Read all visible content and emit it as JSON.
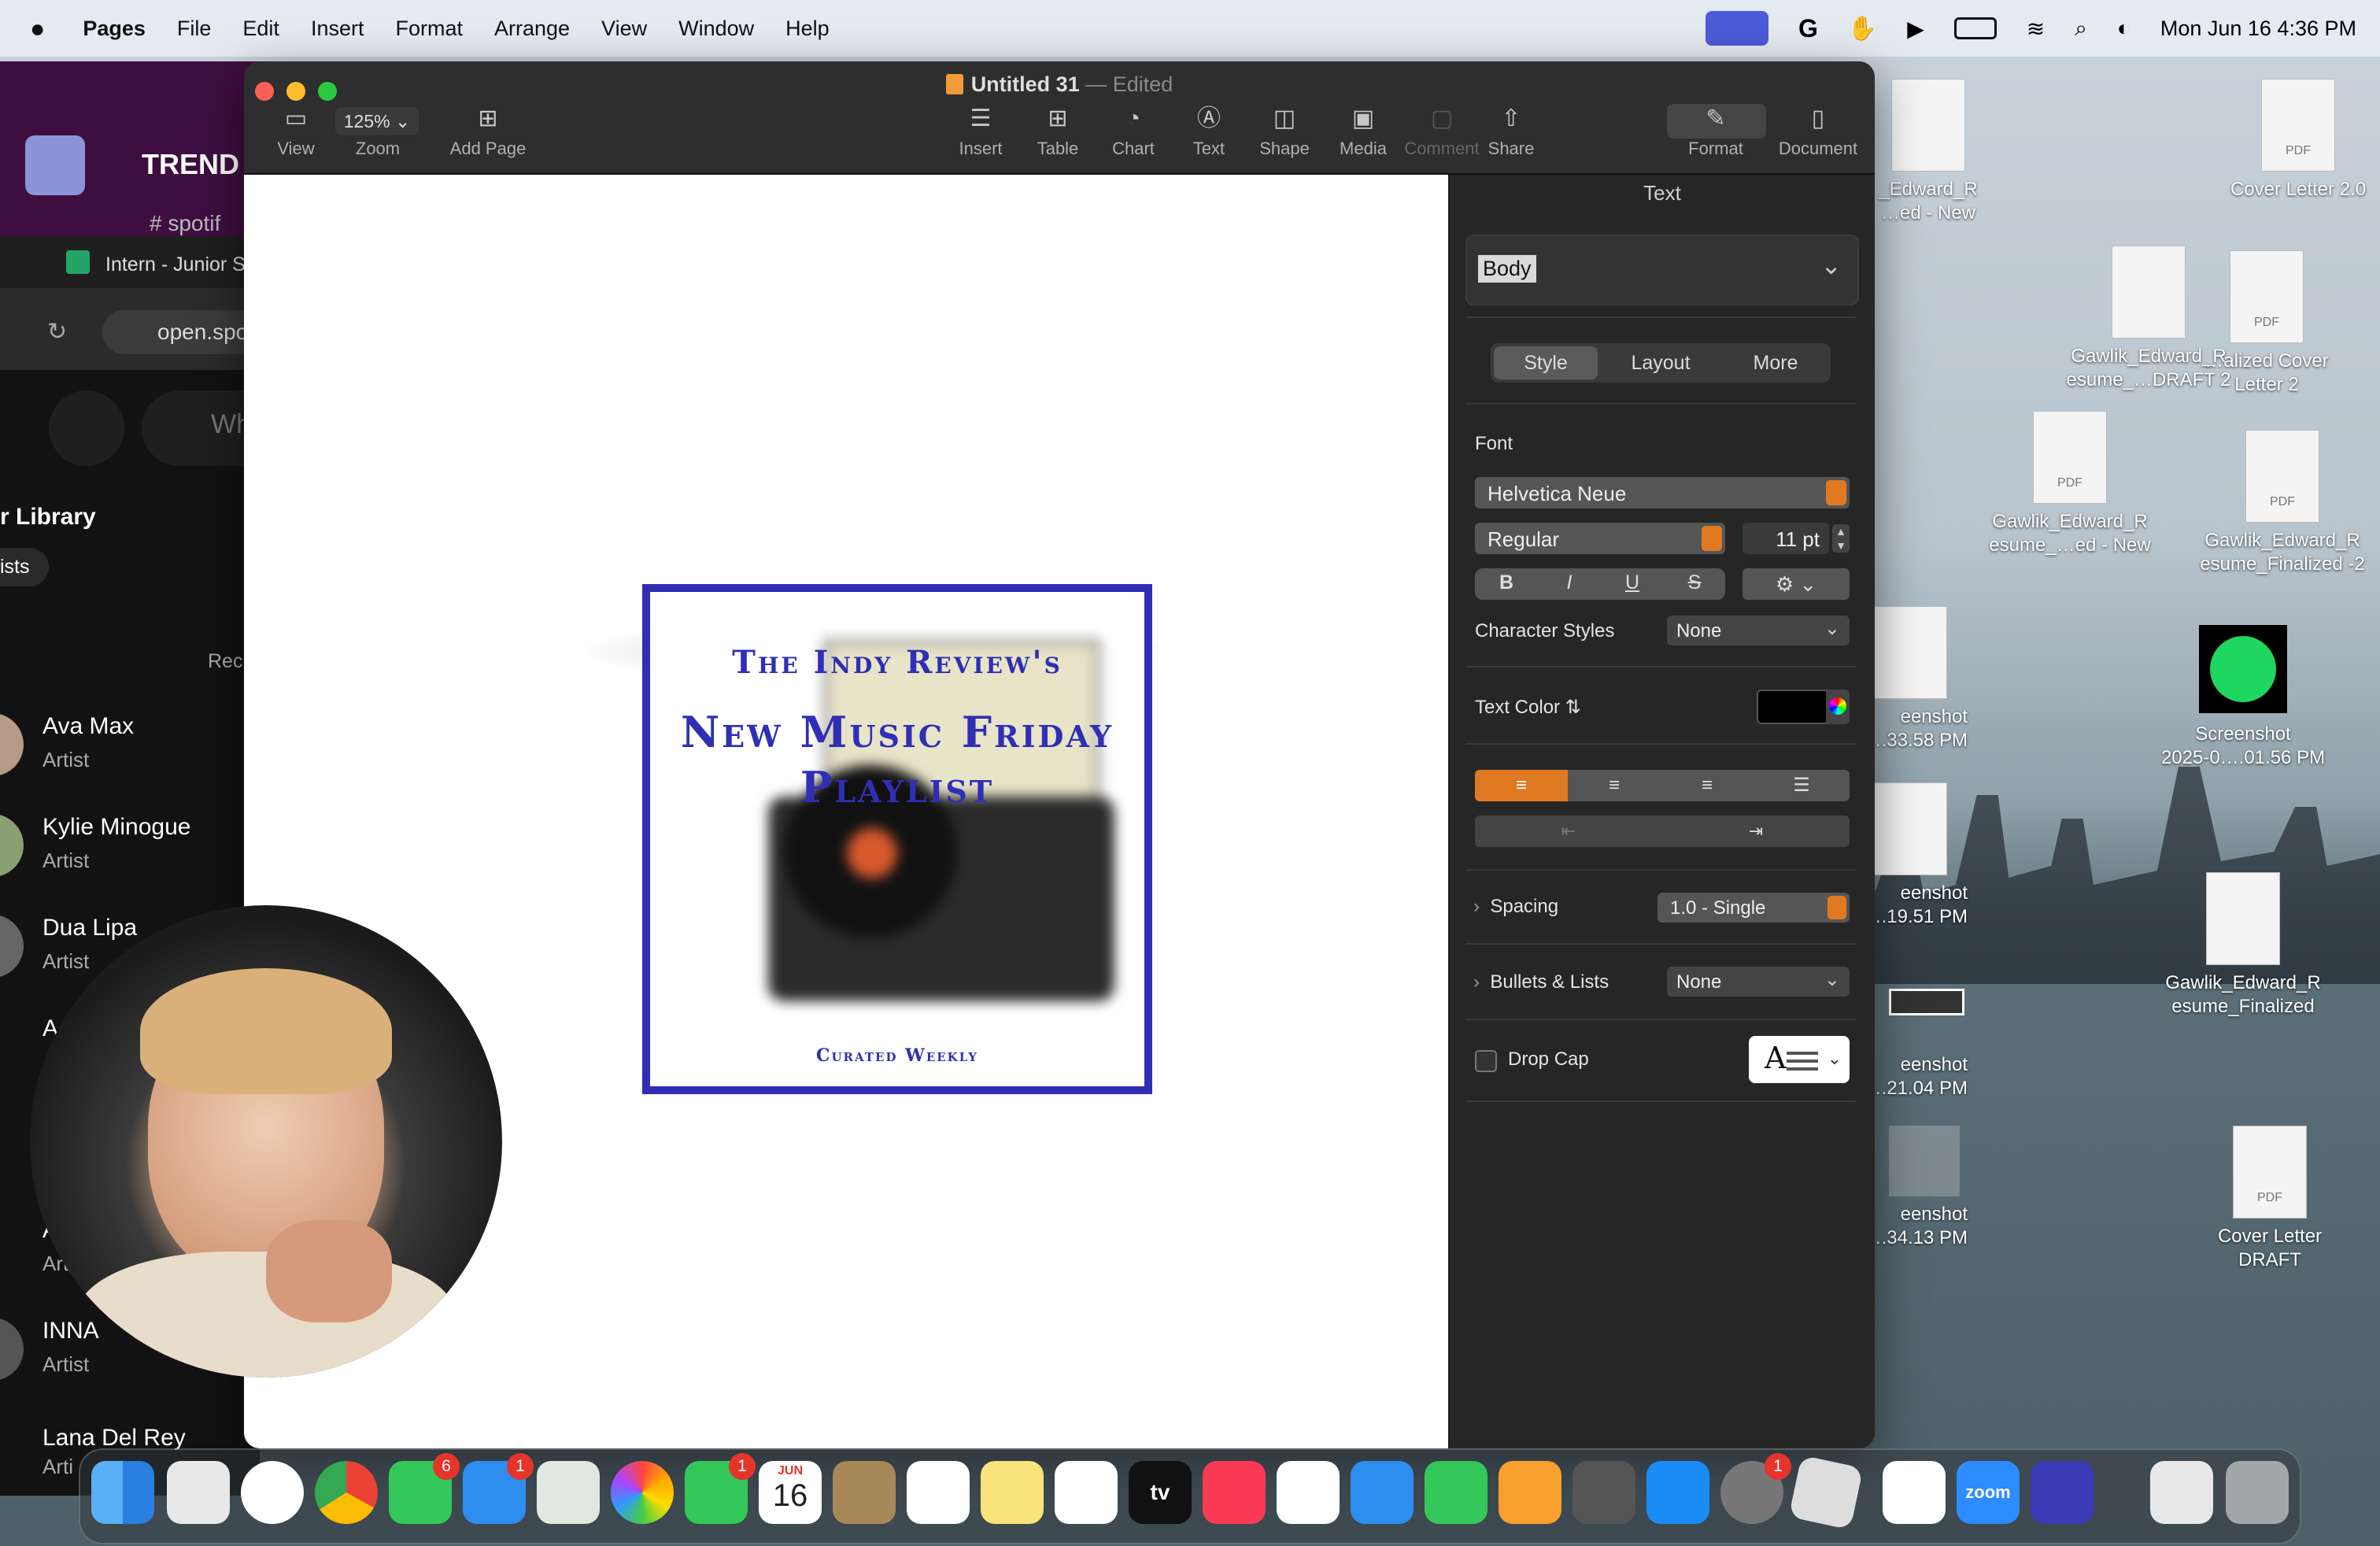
{
  "menubar": {
    "app": "Pages",
    "items": [
      "File",
      "Edit",
      "Insert",
      "Format",
      "Arrange",
      "View",
      "Window",
      "Help"
    ],
    "datetime": "Mon Jun 16  4:36 PM"
  },
  "slack": {
    "workspace": "TREND",
    "channel": "# spotif"
  },
  "chrome": {
    "tab_title": "Intern - Junior S",
    "url": "open.spo"
  },
  "spotify": {
    "search_placeholder": "Wh",
    "library_title": "r Library",
    "filter_chip": "ists",
    "recents_label": "Rec",
    "artists": [
      {
        "name": "Ava Max",
        "sub": "Artist"
      },
      {
        "name": "Kylie Minogue",
        "sub": "Artist"
      },
      {
        "name": "Dua Lipa",
        "sub": "Artist"
      },
      {
        "name": "A",
        "sub": ""
      },
      {
        "name": "A",
        "sub": "Art"
      },
      {
        "name": "INNA",
        "sub": "Artist"
      },
      {
        "name": "Lana Del Rey",
        "sub": "Arti"
      }
    ]
  },
  "pages": {
    "title": "Untitled 31",
    "edited": "— Edited",
    "zoom": "125%",
    "toolbar": {
      "view": "View",
      "zoom": "Zoom",
      "add_page": "Add Page",
      "insert": "Insert",
      "table": "Table",
      "chart": "Chart",
      "text": "Text",
      "shape": "Shape",
      "media": "Media",
      "comment": "Comment",
      "share": "Share",
      "format": "Format",
      "document": "Document"
    },
    "poster": {
      "line1": "The Indy Review's",
      "line2": "New Music Friday",
      "line3": "Playlist",
      "footer": "Curated Weekly",
      "border_color": "#2e2fb4"
    },
    "sidebar": {
      "header": "Text",
      "paragraph_style": "Body",
      "tabs": [
        "Style",
        "Layout",
        "More"
      ],
      "font_label": "Font",
      "font_family": "Helvetica Neue",
      "font_weight": "Regular",
      "font_size": "11 pt",
      "bius": [
        "B",
        "I",
        "U",
        "S"
      ],
      "char_styles_label": "Character Styles",
      "char_styles_value": "None",
      "text_color_label": "Text Color",
      "spacing_label": "Spacing",
      "spacing_value": "1.0 - Single",
      "bullets_label": "Bullets & Lists",
      "bullets_value": "None",
      "dropcap_label": "Drop Cap",
      "dropcap_glyph": "A"
    }
  },
  "desktop_icons": [
    {
      "label1": "_Edward_R",
      "label2": "…ed - New"
    },
    {
      "label1": "Cover Letter 2.0",
      "label2": ""
    },
    {
      "label1": "Gawlik_Edward_R",
      "label2": "esume_…DRAFT 2"
    },
    {
      "label1": "…alized Cover",
      "label2": "Letter 2"
    },
    {
      "label1": "Gawlik_Edward_R",
      "label2": "esume_…ed - New"
    },
    {
      "label1": "Gawlik_Edward_R",
      "label2": "esume_Finalized -2"
    },
    {
      "label1": "eenshot",
      "label2": "….33.58 PM"
    },
    {
      "label1": "Screenshot",
      "label2": "2025-0….01.56 PM"
    },
    {
      "label1": "eenshot",
      "label2": "….19.51 PM"
    },
    {
      "label1": "Gawlik_Edward_R",
      "label2": "esume_Finalized"
    },
    {
      "label1": "eenshot",
      "label2": "….21.04 PM"
    },
    {
      "label1": "eenshot",
      "label2": "….34.13 PM"
    },
    {
      "label1": "Cover Letter",
      "label2": "DRAFT"
    }
  ],
  "dock": {
    "badges": {
      "messages": "6",
      "mail": "1",
      "facetime": "1",
      "settings": "1"
    },
    "calendar_month": "JUN",
    "calendar_day": "16",
    "zoom_label": "zoom",
    "tv_label": "tv"
  },
  "pdf_label": "PDF"
}
